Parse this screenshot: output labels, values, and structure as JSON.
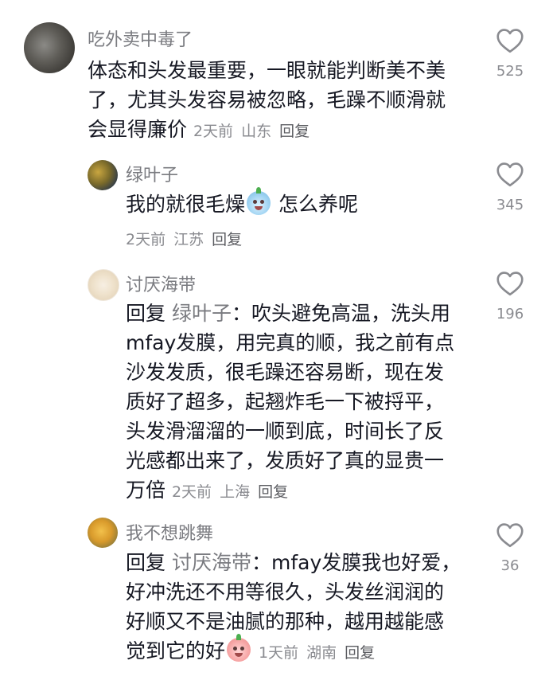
{
  "comments": [
    {
      "username": "吃外卖中毒了",
      "lines": [
        "体态和头发最重要，一眼就能判断美不美",
        "了，尤其头发容易被忽略，毛躁不顺滑就",
        "会显得廉价"
      ],
      "time": "2天前",
      "location": "山东",
      "reply_label": "回复",
      "likes": "525"
    },
    {
      "username": "绿叶子",
      "lines": [
        "我的就很毛燥",
        "怎么养呢"
      ],
      "time": "2天前",
      "location": "江苏",
      "reply_label": "回复",
      "likes": "345"
    },
    {
      "username": "讨厌海带",
      "reply_prefix": "回复",
      "reply_target": "绿叶子",
      "lines": [
        "：吹头避免高温，洗头用",
        "mfay发膜，用完真的顺，我之前有点",
        "沙发发质，很毛躁还容易断，现在发",
        "质好了超多，起翘炸毛一下被捋平，",
        "头发滑溜溜的一顺到底，时间长了反",
        "光感都出来了，发质好了真的显贵一",
        "万倍"
      ],
      "time": "2天前",
      "location": "上海",
      "reply_label": "回复",
      "likes": "196"
    },
    {
      "username": "我不想跳舞",
      "reply_prefix": "回复",
      "reply_target": "讨厌海带",
      "lines": [
        "：mfay发膜我也好爱，",
        "好冲洗还不用等很久，头发丝润润的",
        "好顺又不是油腻的那种，越用越能感",
        "觉到它的好"
      ],
      "time": "1天前",
      "location": "湖南",
      "reply_label": "回复",
      "likes": "36"
    }
  ],
  "icons": {
    "like": "heart-outline-icon",
    "emoji_1": "crying-face-emoji-icon",
    "emoji_2": "pleading-face-emoji-icon"
  },
  "colors": {
    "text": "#161823",
    "secondary": "#7a7b80",
    "meta": "#8a8b90"
  }
}
